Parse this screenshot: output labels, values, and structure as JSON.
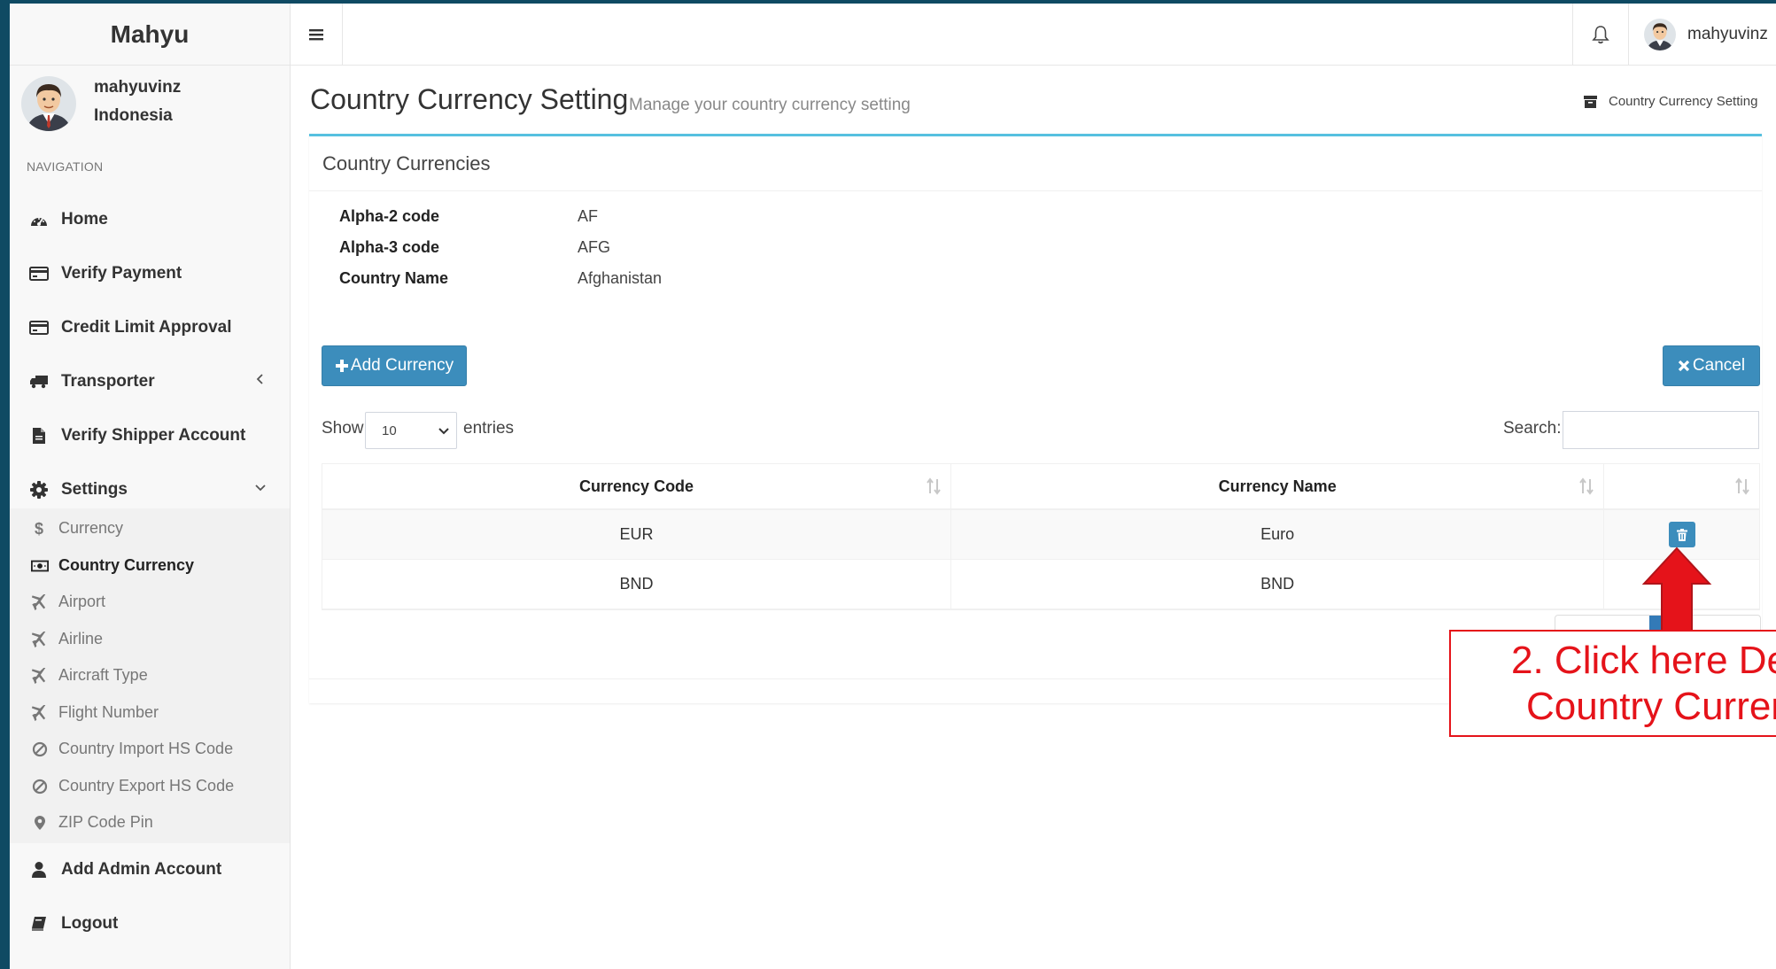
{
  "brand": "Mahyu",
  "user": {
    "name": "mahyuvinz",
    "country": "Indonesia"
  },
  "nav": {
    "header": "NAVIGATION",
    "items": [
      {
        "label": "Home",
        "icon": "dashboard-icon"
      },
      {
        "label": "Verify Payment",
        "icon": "credit-card-icon"
      },
      {
        "label": "Credit Limit Approval",
        "icon": "credit-card-icon"
      },
      {
        "label": "Transporter",
        "icon": "truck-icon"
      },
      {
        "label": "Verify Shipper Account",
        "icon": "file-icon"
      },
      {
        "label": "Settings",
        "icon": "gear-icon"
      },
      {
        "label": "Add Admin Account",
        "icon": "user-icon"
      },
      {
        "label": "Logout",
        "icon": "book-icon"
      }
    ],
    "settings_sub": [
      {
        "label": "Currency",
        "icon": "dollar-icon"
      },
      {
        "label": "Country Currency",
        "icon": "money-icon",
        "active": true
      },
      {
        "label": "Airport",
        "icon": "plane-icon"
      },
      {
        "label": "Airline",
        "icon": "plane-icon"
      },
      {
        "label": "Aircraft Type",
        "icon": "plane-icon"
      },
      {
        "label": "Flight Number",
        "icon": "plane-icon"
      },
      {
        "label": "Country Import HS Code",
        "icon": "ban-icon"
      },
      {
        "label": "Country Export HS Code",
        "icon": "ban-icon"
      },
      {
        "label": "ZIP Code Pin",
        "icon": "map-marker-icon"
      }
    ]
  },
  "topbar": {
    "username": "mahyuvinz"
  },
  "page": {
    "title": "Country Currency Setting",
    "subtitle": "Manage your country currency setting",
    "breadcrumb": "Country Currency Setting"
  },
  "box": {
    "title": "Country Currencies",
    "info": [
      {
        "label": "Alpha-2 code",
        "value": "AF"
      },
      {
        "label": "Alpha-3 code",
        "value": "AFG"
      },
      {
        "label": "Country Name",
        "value": "Afghanistan"
      }
    ],
    "add_button": "Add Currency",
    "cancel_button": "Cancel"
  },
  "table": {
    "show_label": "Show",
    "entries_value": "10",
    "entries_label": "entries",
    "search_label": "Search:",
    "search_value": "",
    "columns": [
      "Currency Code",
      "Currency Name",
      ""
    ],
    "rows": [
      {
        "code": "EUR",
        "name": "Euro"
      },
      {
        "code": "BND",
        "name": "BND"
      }
    ]
  },
  "annotation": {
    "line1": "2. Click here De",
    "line2": "Country Curren",
    "color": "#e5131a"
  },
  "colors": {
    "primary": "#3c8dbc",
    "box_accent": "#56c0e0",
    "background": "#0f4a63"
  }
}
